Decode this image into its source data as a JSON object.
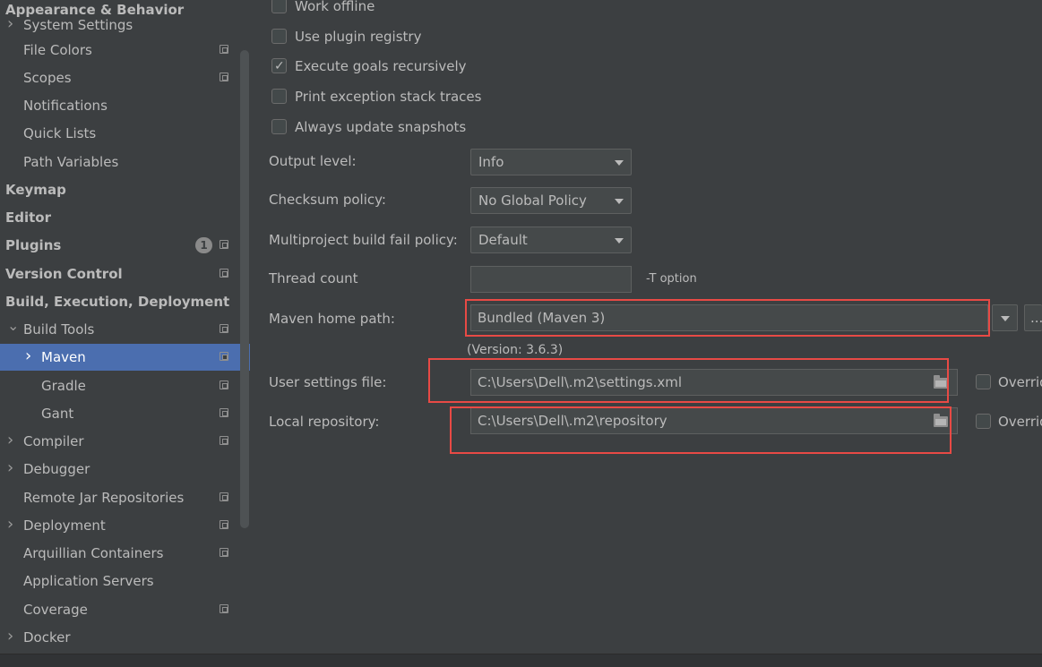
{
  "sidebar": {
    "items": [
      {
        "label": "Appearance & Behavior",
        "bold": true,
        "indent": 0
      },
      {
        "label": "System Settings",
        "arrow": true,
        "indent": 1
      },
      {
        "label": "File Colors",
        "indent": 1,
        "copy": true
      },
      {
        "label": "Scopes",
        "indent": 1,
        "copy": true
      },
      {
        "label": "Notifications",
        "indent": 1
      },
      {
        "label": "Quick Lists",
        "indent": 1
      },
      {
        "label": "Path Variables",
        "indent": 1
      },
      {
        "label": "Keymap",
        "bold": true,
        "indent": 0
      },
      {
        "label": "Editor",
        "bold": true,
        "indent": 0
      },
      {
        "label": "Plugins",
        "bold": true,
        "indent": 0,
        "badge": "1",
        "copy": true
      },
      {
        "label": "Version Control",
        "bold": true,
        "indent": 0,
        "copy": true
      },
      {
        "label": "Build, Execution, Deployment",
        "bold": true,
        "indent": 0
      },
      {
        "label": "Build Tools",
        "arrow": true,
        "expanded": true,
        "indent": 1,
        "copy": true
      },
      {
        "label": "Maven",
        "arrow": true,
        "indent": 2,
        "copy": true,
        "selected": true
      },
      {
        "label": "Gradle",
        "indent": 2,
        "copy": true
      },
      {
        "label": "Gant",
        "indent": 2,
        "copy": true
      },
      {
        "label": "Compiler",
        "arrow": true,
        "indent": 1,
        "copy": true
      },
      {
        "label": "Debugger",
        "arrow": true,
        "indent": 1
      },
      {
        "label": "Remote Jar Repositories",
        "indent": 1,
        "copy": true
      },
      {
        "label": "Deployment",
        "arrow": true,
        "indent": 1,
        "copy": true
      },
      {
        "label": "Arquillian Containers",
        "indent": 1,
        "copy": true
      },
      {
        "label": "Application Servers",
        "indent": 1
      },
      {
        "label": "Coverage",
        "indent": 1,
        "copy": true
      },
      {
        "label": "Docker",
        "arrow": true,
        "indent": 1
      }
    ]
  },
  "main": {
    "checkboxes": [
      {
        "label": "Work offline",
        "checked": false
      },
      {
        "label": "Use plugin registry",
        "checked": false
      },
      {
        "label": "Execute goals recursively",
        "checked": true
      },
      {
        "label": "Print exception stack traces",
        "checked": false
      },
      {
        "label": "Always update snapshots",
        "checked": false
      }
    ],
    "output_level": {
      "label": "Output level:",
      "value": "Info"
    },
    "checksum_policy": {
      "label": "Checksum policy:",
      "value": "No Global Policy"
    },
    "fail_policy": {
      "label": "Multiproject build fail policy:",
      "value": "Default"
    },
    "thread_count": {
      "label": "Thread count",
      "value": "",
      "hint": "-T option"
    },
    "maven_home": {
      "label": "Maven home path:",
      "value": "Bundled (Maven 3)",
      "browse": "...",
      "version": "(Version: 3.6.3)"
    },
    "user_settings": {
      "label": "User settings file:",
      "value": "C:\\Users\\Dell\\.m2\\settings.xml",
      "override": "Overrid"
    },
    "local_repo": {
      "label": "Local repository:",
      "value": "C:\\Users\\Dell\\.m2\\repository",
      "override": "Overrid"
    }
  },
  "colors": {
    "background": "#3c3f41",
    "selection": "#4b6eaf",
    "highlight": "#e84a45"
  }
}
